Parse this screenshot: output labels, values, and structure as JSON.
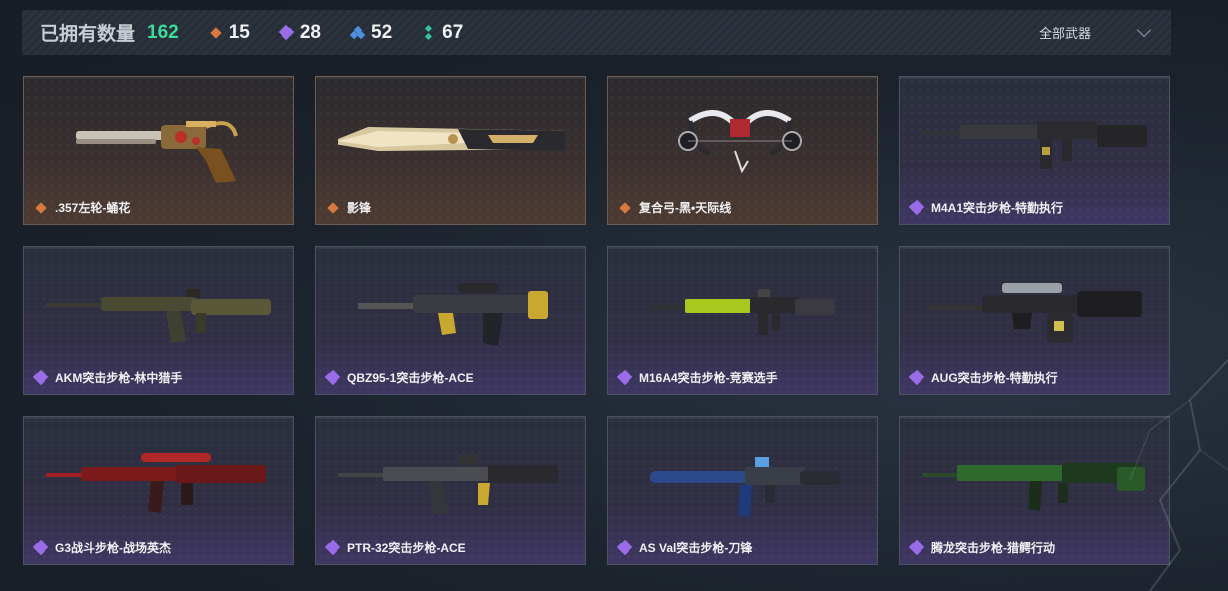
{
  "header": {
    "owned_label": "已拥有数量",
    "owned_count": "162",
    "stats": [
      {
        "icon": "orange-diamond-icon",
        "value": "15",
        "color": "#d97a3c"
      },
      {
        "icon": "purple-diamond-icon",
        "value": "28",
        "color": "#9b6ce8"
      },
      {
        "icon": "blue-diamond-icon",
        "value": "52",
        "color": "#4d8fe0"
      },
      {
        "icon": "green-diamond-icon",
        "value": "67",
        "color": "#2fc49a"
      }
    ],
    "filter_label": "全部武器"
  },
  "cards": [
    {
      "name": ".357左轮-蛹花",
      "rarity": "orange",
      "icon": "revolver-icon"
    },
    {
      "name": "影锋",
      "rarity": "orange",
      "icon": "blade-icon"
    },
    {
      "name": "复合弓-黑•天际线",
      "rarity": "orange",
      "icon": "bow-icon"
    },
    {
      "name": "M4A1突击步枪-特勤执行",
      "rarity": "purple",
      "icon": "rifle-icon"
    },
    {
      "name": "AKM突击步枪-林中猎手",
      "rarity": "purple",
      "icon": "rifle-icon"
    },
    {
      "name": "QBZ95-1突击步枪-ACE",
      "rarity": "purple",
      "icon": "bullpup-rifle-icon"
    },
    {
      "name": "M16A4突击步枪-竞赛选手",
      "rarity": "purple",
      "icon": "rifle-icon"
    },
    {
      "name": "AUG突击步枪-特勤执行",
      "rarity": "purple",
      "icon": "bullpup-rifle-icon"
    },
    {
      "name": "G3战斗步枪-战场英杰",
      "rarity": "purple",
      "icon": "rifle-icon"
    },
    {
      "name": "PTR-32突击步枪-ACE",
      "rarity": "purple",
      "icon": "rifle-icon"
    },
    {
      "name": "AS Val突击步枪-刀锋",
      "rarity": "purple",
      "icon": "rifle-icon"
    },
    {
      "name": "腾龙突击步枪-猎鳄行动",
      "rarity": "purple",
      "icon": "rifle-icon"
    }
  ]
}
